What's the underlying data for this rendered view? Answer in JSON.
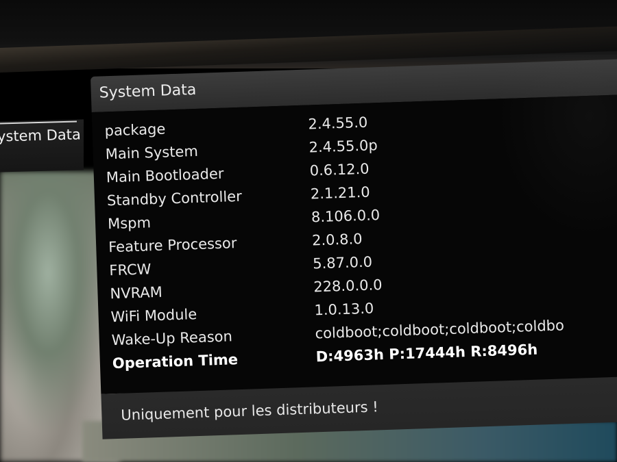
{
  "left_menu": {
    "active_item": "ystem Data"
  },
  "panel": {
    "title": "System Data",
    "rows": [
      {
        "label": "package",
        "value": "2.4.55.0"
      },
      {
        "label": "Main System",
        "value": "2.4.55.0p"
      },
      {
        "label": "Main Bootloader",
        "value": "0.6.12.0"
      },
      {
        "label": "Standby Controller",
        "value": "2.1.21.0"
      },
      {
        "label": "Mspm",
        "value": "8.106.0.0"
      },
      {
        "label": "Feature Processor",
        "value": "2.0.8.0"
      },
      {
        "label": "FRCW",
        "value": "5.87.0.0"
      },
      {
        "label": "NVRAM",
        "value": "228.0.0.0"
      },
      {
        "label": "WiFi Module",
        "value": "1.0.13.0"
      },
      {
        "label": "Wake-Up Reason",
        "value": "coldboot;coldboot;coldboot;coldbo"
      },
      {
        "label": "Operation Time",
        "value": "D:4963h P:17444h R:8496h"
      }
    ],
    "footer": "Uniquement pour les distributeurs !"
  }
}
